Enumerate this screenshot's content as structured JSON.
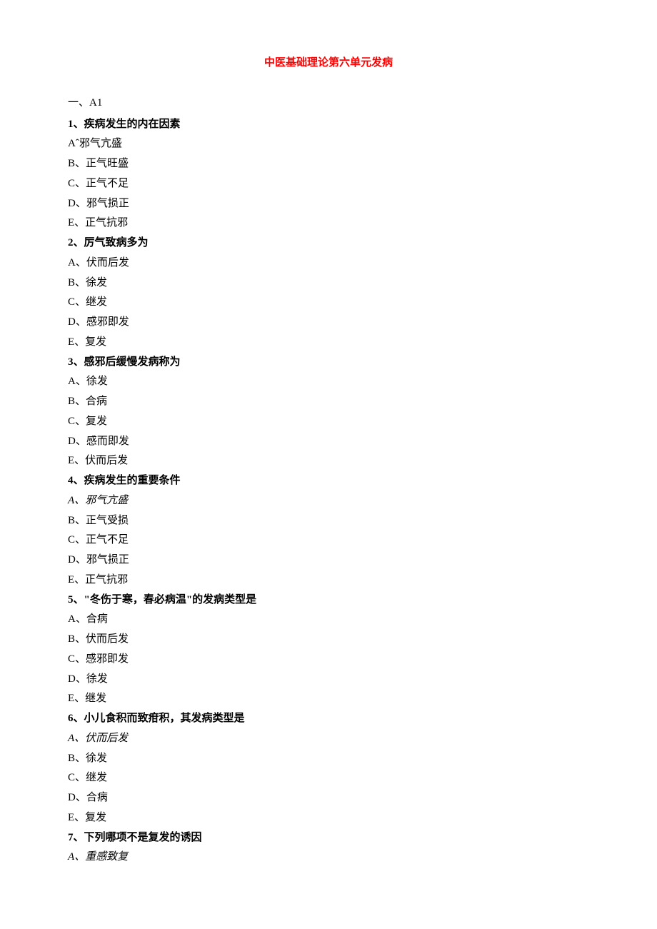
{
  "title": "中医基础理论第六单元发病",
  "section_header": "一、A1",
  "questions": [
    {
      "stem": "1、疾病发生的内在因素",
      "options": [
        "Aˆ邪气亢盛",
        "B、正气旺盛",
        "C、正气不足",
        "D、邪气损正",
        "E、正气抗邪"
      ]
    },
    {
      "stem": "2、厉气致病多为",
      "options": [
        "A、伏而后发",
        "B、徐发",
        "C、继发",
        "D、感邪即发",
        "E、复发"
      ]
    },
    {
      "stem": "3、感邪后缓慢发病称为",
      "options": [
        "A、徐发",
        "B、合病",
        "C、复发",
        "D、感而即发",
        "E、伏而后发"
      ]
    },
    {
      "stem": "4、疾病发生的重要条件",
      "options": [
        "A、邪气亢盛",
        "B、正气受损",
        "C、正气不足",
        "D、邪气损正",
        "E、正气抗邪"
      ]
    },
    {
      "stem": "5、\"冬伤于寒，春必病温\"的发病类型是",
      "options": [
        "A、合病",
        "B、伏而后发",
        "C、感邪即发",
        "D、徐发",
        "E、继发"
      ]
    },
    {
      "stem": "6、小儿食积而致疳积，其发病类型是",
      "options": [
        "A、伏而后发",
        "B、徐发",
        "C、继发",
        "D、合病",
        "E、复发"
      ]
    },
    {
      "stem": "7、下列哪项不是复发的诱因",
      "options": [
        "A、重感致复"
      ]
    }
  ]
}
